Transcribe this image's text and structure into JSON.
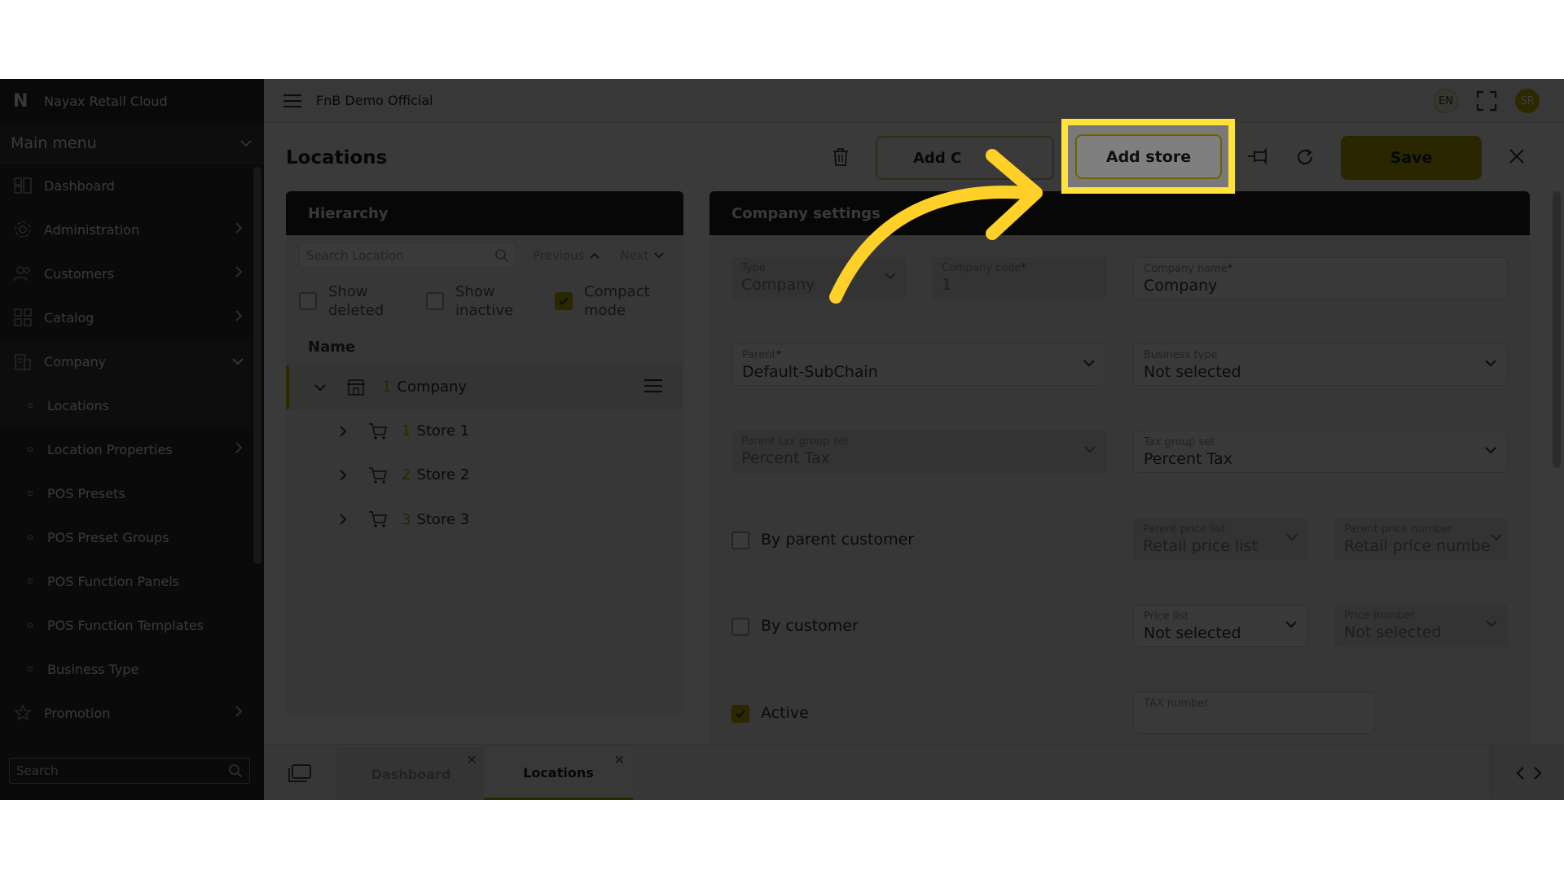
{
  "brand": {
    "logo": "N",
    "name": "Nayax Retail Cloud"
  },
  "sidebar": {
    "section_label": "Main menu",
    "items": [
      {
        "label": "Dashboard",
        "icon": "dashboard-icon"
      },
      {
        "label": "Administration",
        "icon": "gear-icon"
      },
      {
        "label": "Customers",
        "icon": "users-icon"
      },
      {
        "label": "Catalog",
        "icon": "grid-icon"
      },
      {
        "label": "Company",
        "icon": "building-icon"
      }
    ],
    "company_sub": [
      "Locations",
      "Location Properties",
      "POS Presets",
      "POS Preset Groups",
      "POS Function Panels",
      "POS Function Templates",
      "Business Type"
    ],
    "promotion_label": "Promotion",
    "search_placeholder": "Search"
  },
  "topbar": {
    "org_name": "FnB Demo Official",
    "lang": "EN",
    "avatar": "SR"
  },
  "page": {
    "title": "Locations"
  },
  "toolbar": {
    "add_company_label": "Add C",
    "add_store_label": "Add store",
    "save_label": "Save"
  },
  "hierarchy": {
    "title": "Hierarchy",
    "search_placeholder": "Search Location",
    "previous_label": "Previous",
    "next_label": "Next",
    "show_deleted_label": "Show deleted",
    "show_inactive_label": "Show inactive",
    "compact_mode_label": "Compact mode",
    "column_name": "Name",
    "root": {
      "num": "1",
      "label": "Company"
    },
    "stores": [
      {
        "num": "1",
        "label": "Store 1"
      },
      {
        "num": "2",
        "label": "Store 2"
      },
      {
        "num": "3",
        "label": "Store 3"
      }
    ]
  },
  "settings": {
    "title": "Company settings",
    "type_label": "Type",
    "type_value": "Company",
    "company_code_label": "Company code",
    "company_code_value": "1",
    "company_name_label": "Company name",
    "company_name_value": "Company",
    "parent_label": "Parent",
    "parent_value": "Default-SubChain",
    "business_type_label": "Business type",
    "business_type_value": "Not selected",
    "parent_tax_label": "Parent tax group set",
    "parent_tax_value": "Percent Tax",
    "tax_group_label": "Tax group set",
    "tax_group_value": "Percent Tax",
    "by_parent_customer_label": "By parent customer",
    "parent_price_list_label": "Parent price list",
    "parent_price_list_value": "Retail price list",
    "parent_price_number_label": "Parent price number",
    "parent_price_number_value": "Retail price numbe",
    "by_customer_label": "By customer",
    "price_list_label": "Price list",
    "price_list_value": "Not selected",
    "price_number_label": "Price number",
    "price_number_value": "Not selected",
    "active_label": "Active",
    "tax_number_label": "TAX number",
    "tax_number_value": ""
  },
  "tabs": [
    {
      "label": "Dashboard"
    },
    {
      "label": "Locations"
    }
  ],
  "colors": {
    "accent": "#b5a800",
    "highlight": "#ffe23a",
    "dark": "#2b2b2b"
  }
}
